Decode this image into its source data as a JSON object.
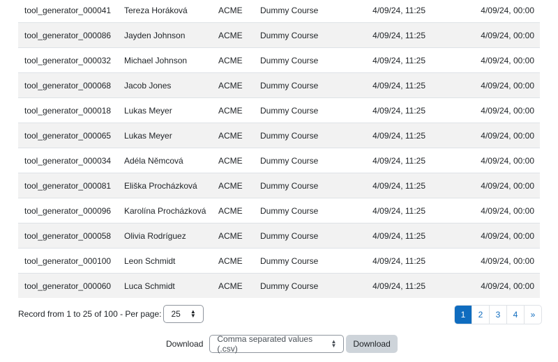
{
  "rows": [
    [
      "tool_generator_000041",
      "Tereza Horáková",
      "ACME",
      "Dummy Course",
      "4/09/24, 11:25",
      "4/09/24, 00:00"
    ],
    [
      "tool_generator_000086",
      "Jayden Johnson",
      "ACME",
      "Dummy Course",
      "4/09/24, 11:25",
      "4/09/24, 00:00"
    ],
    [
      "tool_generator_000032",
      "Michael Johnson",
      "ACME",
      "Dummy Course",
      "4/09/24, 11:25",
      "4/09/24, 00:00"
    ],
    [
      "tool_generator_000068",
      "Jacob Jones",
      "ACME",
      "Dummy Course",
      "4/09/24, 11:25",
      "4/09/24, 00:00"
    ],
    [
      "tool_generator_000018",
      "Lukas Meyer",
      "ACME",
      "Dummy Course",
      "4/09/24, 11:25",
      "4/09/24, 00:00"
    ],
    [
      "tool_generator_000065",
      "Lukas Meyer",
      "ACME",
      "Dummy Course",
      "4/09/24, 11:25",
      "4/09/24, 00:00"
    ],
    [
      "tool_generator_000034",
      "Adéla Němcová",
      "ACME",
      "Dummy Course",
      "4/09/24, 11:25",
      "4/09/24, 00:00"
    ],
    [
      "tool_generator_000081",
      "Eliška Procházková",
      "ACME",
      "Dummy Course",
      "4/09/24, 11:25",
      "4/09/24, 00:00"
    ],
    [
      "tool_generator_000096",
      "Karolína Procházková",
      "ACME",
      "Dummy Course",
      "4/09/24, 11:25",
      "4/09/24, 00:00"
    ],
    [
      "tool_generator_000058",
      "Olivia Rodríguez",
      "ACME",
      "Dummy Course",
      "4/09/24, 11:25",
      "4/09/24, 00:00"
    ],
    [
      "tool_generator_000100",
      "Leon Schmidt",
      "ACME",
      "Dummy Course",
      "4/09/24, 11:25",
      "4/09/24, 00:00"
    ],
    [
      "tool_generator_000060",
      "Luca Schmidt",
      "ACME",
      "Dummy Course",
      "4/09/24, 11:25",
      "4/09/24, 00:00"
    ]
  ],
  "footer": {
    "record_text": "Record from 1 to 25 of 100 - Per page:",
    "per_page": "25"
  },
  "pagination": {
    "pages": [
      "1",
      "2",
      "3",
      "4"
    ],
    "next": "»",
    "active": "1"
  },
  "download": {
    "label": "Download",
    "format": "Comma separated values (.csv)",
    "button": "Download"
  }
}
